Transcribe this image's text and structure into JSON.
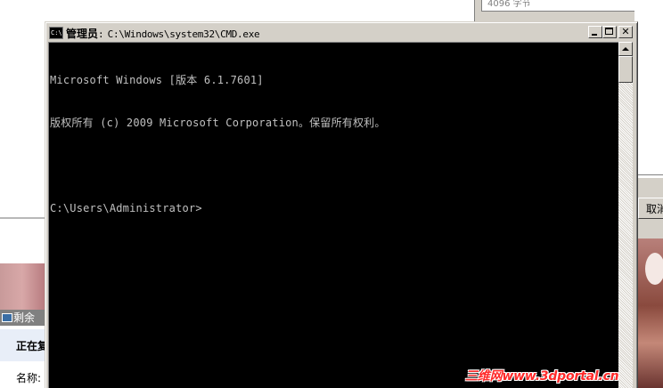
{
  "background": {
    "right_dialog": {
      "bytes_text": "4096 字节",
      "cancel_label": "取消"
    },
    "left_dialog": {
      "title": "剩余",
      "progress_label": "正在复",
      "name_label": "名称:"
    }
  },
  "cmd_window": {
    "title_admin": "管理员",
    "title_separator": ":",
    "title_path": "C:\\Windows\\system32\\CMD.exe",
    "icon_label": "C:\\",
    "console_lines": [
      "Microsoft Windows [版本 6.1.7601]",
      "版权所有 (c) 2009 Microsoft Corporation。保留所有权利。",
      "",
      "C:\\Users\\Administrator>"
    ]
  },
  "watermark": "三维网www.3dportal.cn",
  "colors": {
    "console_bg": "#000000",
    "console_fg": "#c0c0c0",
    "window_face": "#d4d0c8",
    "watermark": "#ff2a2a"
  }
}
